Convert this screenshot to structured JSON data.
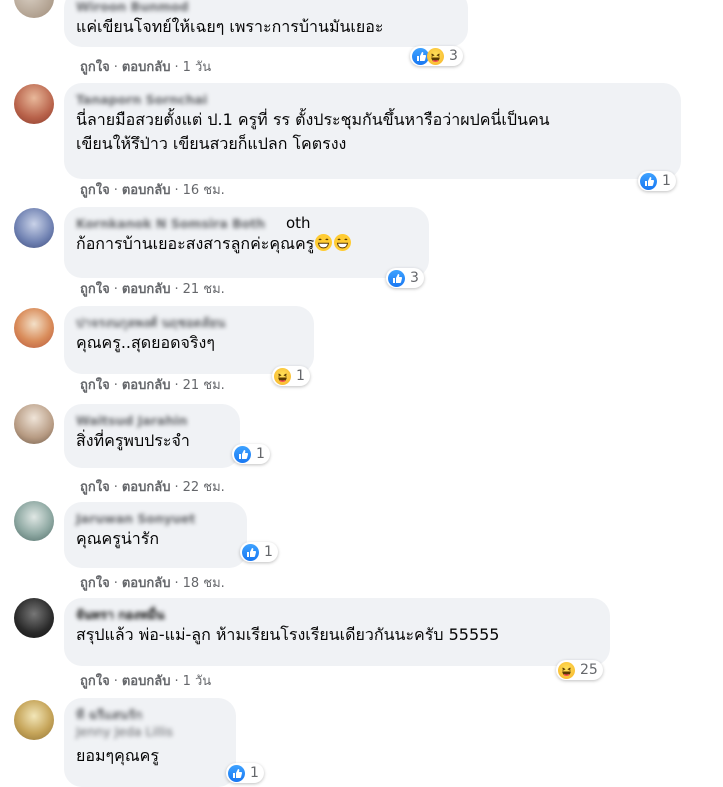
{
  "labels": {
    "like": "ถูกใจ",
    "reply": "ตอบกลับ",
    "separator": "·"
  },
  "comments": [
    {
      "author": "Wiroon Bunmod",
      "text": "แค่เขียนโจทย์ให้เฉยๆ เพราะการบ้านมันเยอะ",
      "time": "1 วัน",
      "reactions": [
        "like",
        "haha"
      ],
      "count": "3"
    },
    {
      "author": "Tanaporn Sornchai",
      "text": [
        "นี่ลายมือสวยตั้งแต่ ป.1 ครูที่ รร ตั้งประชุมกันขึ้นหารือว่าผปคนี่เป็นคน",
        "เขียนให้รึป่าว เขียนสวยก็แปลก โคตรงง"
      ],
      "time": "16 ชม.",
      "reactions": [
        "like"
      ],
      "count": "1"
    },
    {
      "author": "Kornkanok N Somsira Both",
      "author_tail": "oth",
      "text": "ก้อการบ้านเยอะสงสารลูกค่ะคุณครู",
      "text_emoji": "grinning-face",
      "time": "21 ชม.",
      "reactions": [
        "like"
      ],
      "count": "3"
    },
    {
      "author": "ปาจรงนกุลพงศ์ นฤชอดลัยน",
      "text": "คุณครู..สุดยอดจริงๆ",
      "time": "21 ชม.",
      "reactions": [
        "haha"
      ],
      "count": "1"
    },
    {
      "author": "Waitsud Jarahin",
      "text": "สิ่งที่ครูพบประจำ",
      "time": "22 ชม.",
      "reactions": [
        "like"
      ],
      "count": "1"
    },
    {
      "author": "Jaruwan Sonyuet",
      "text": "คุณครูน่ารัก",
      "time": "18 ชม.",
      "reactions": [
        "like"
      ],
      "count": "1"
    },
    {
      "author": "จันทรา กองหมื่น",
      "text": "สรุปแล้ว พ่อ-แม่-ลูก ห้ามเรียนโรงเรียนเดียวกันนะครับ 55555",
      "time": "1 วัน",
      "reactions": [
        "haha"
      ],
      "count": "25"
    },
    {
      "author": "ที ฉรีแสนรัก",
      "author2": "Jenny Jeda Lillis",
      "text": "ยอมๆคุณครู",
      "reactions": [
        "like"
      ],
      "count": "1"
    }
  ],
  "colors": {
    "bubble": "#f0f2f5",
    "like": "#1877f2",
    "haha": "#f7b125",
    "meta": "#65676b"
  }
}
